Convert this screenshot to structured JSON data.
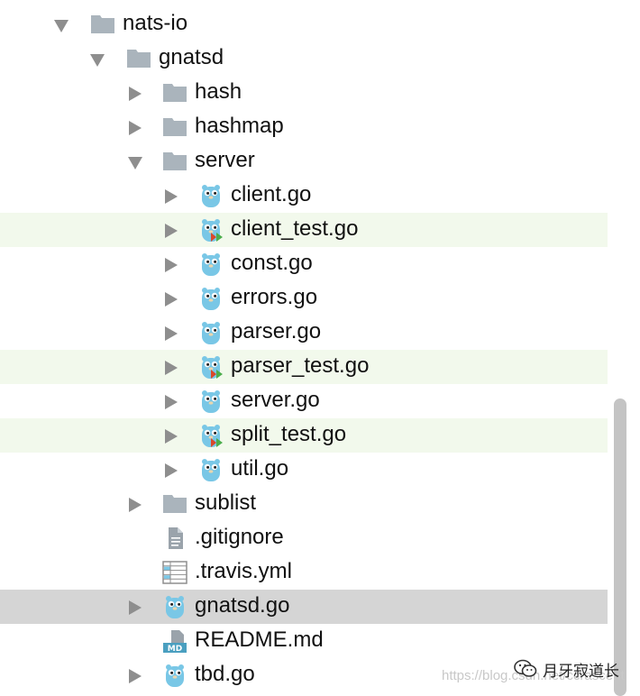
{
  "tree": [
    {
      "label": "nats-io",
      "type": "folder",
      "depth": 0,
      "expanded": true
    },
    {
      "label": "gnatsd",
      "type": "folder",
      "depth": 1,
      "expanded": true
    },
    {
      "label": "hash",
      "type": "folder",
      "depth": 2,
      "expanded": false
    },
    {
      "label": "hashmap",
      "type": "folder",
      "depth": 2,
      "expanded": false
    },
    {
      "label": "server",
      "type": "folder",
      "depth": 2,
      "expanded": true
    },
    {
      "label": "client.go",
      "type": "go",
      "depth": 3,
      "expandable": true
    },
    {
      "label": "client_test.go",
      "type": "go-test",
      "depth": 3,
      "expandable": true,
      "highlight": "test"
    },
    {
      "label": "const.go",
      "type": "go",
      "depth": 3,
      "expandable": true
    },
    {
      "label": "errors.go",
      "type": "go",
      "depth": 3,
      "expandable": true
    },
    {
      "label": "parser.go",
      "type": "go",
      "depth": 3,
      "expandable": true
    },
    {
      "label": "parser_test.go",
      "type": "go-test",
      "depth": 3,
      "expandable": true,
      "highlight": "test"
    },
    {
      "label": "server.go",
      "type": "go",
      "depth": 3,
      "expandable": true
    },
    {
      "label": "split_test.go",
      "type": "go-test",
      "depth": 3,
      "expandable": true,
      "highlight": "test"
    },
    {
      "label": "util.go",
      "type": "go",
      "depth": 3,
      "expandable": true
    },
    {
      "label": "sublist",
      "type": "folder",
      "depth": 2,
      "expanded": false
    },
    {
      "label": ".gitignore",
      "type": "text",
      "depth": 2,
      "expandable": false
    },
    {
      "label": ".travis.yml",
      "type": "yaml",
      "depth": 2,
      "expandable": false
    },
    {
      "label": "gnatsd.go",
      "type": "go",
      "depth": 2,
      "expandable": true,
      "highlight": "selected"
    },
    {
      "label": "README.md",
      "type": "md",
      "depth": 2,
      "expandable": false
    },
    {
      "label": "tbd.go",
      "type": "go",
      "depth": 2,
      "expandable": true
    }
  ],
  "watermark": {
    "url_text": "https://blog.csdn.net/ccrascent",
    "brand_text": "月牙寂道长",
    "brand_icon": "wechat-icon"
  },
  "colors": {
    "folder": "#aab4bc",
    "gopher": "#79c7e6",
    "arrow": "#8e8e8e",
    "test_row": "#f2f9ec",
    "selected_row": "#d5d5d5"
  }
}
